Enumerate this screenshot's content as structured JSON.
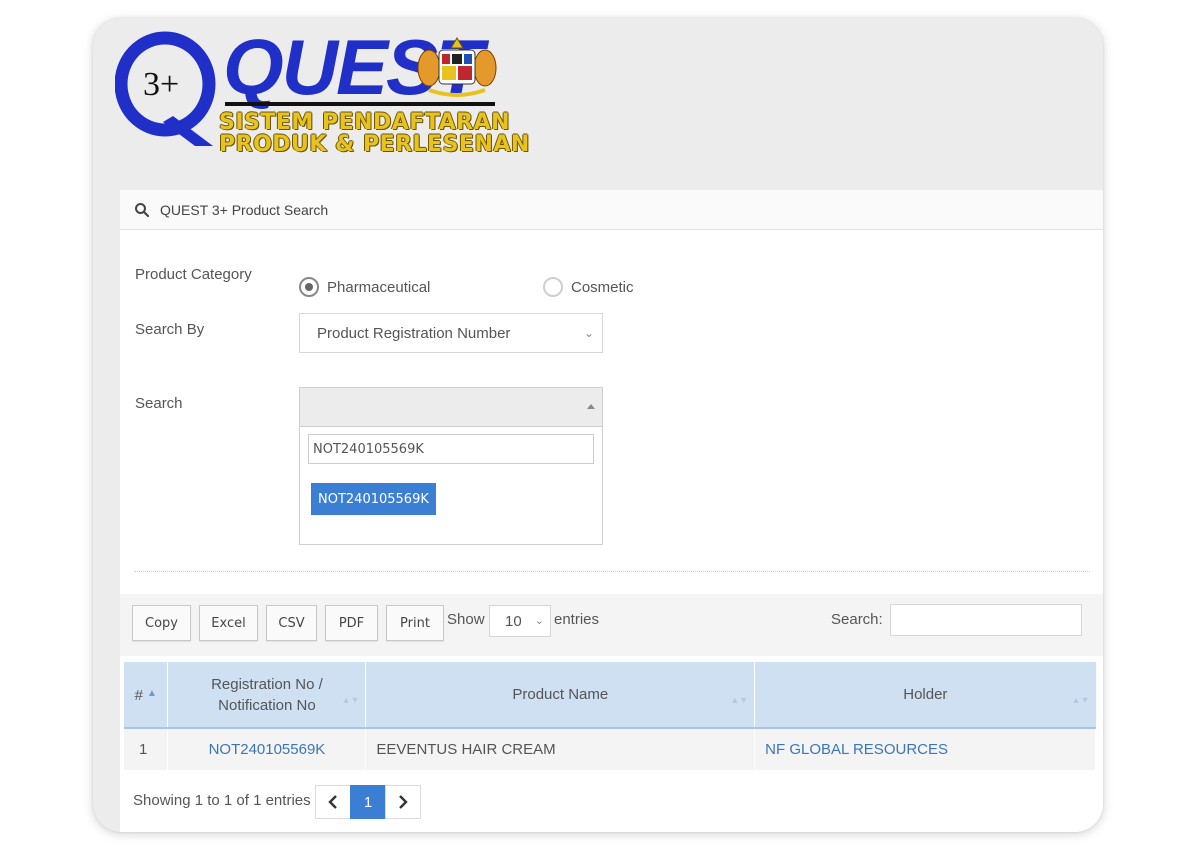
{
  "logo": {
    "text": "QUEST",
    "badge": "3+",
    "line1": "SISTEM PENDAFTARAN",
    "line2": "PRODUK & PERLESENAN"
  },
  "panel": {
    "title": "QUEST 3+ Product Search",
    "icon": "search-icon"
  },
  "form": {
    "category_label": "Product Category",
    "category_options": [
      "Pharmaceutical",
      "Cosmetic"
    ],
    "category_selected": "Pharmaceutical",
    "search_by_label": "Search By",
    "search_by_value": "Product Registration Number",
    "search_label": "Search",
    "search_typed": "NOT240105569K",
    "search_result": "NOT240105569K"
  },
  "toolbar": {
    "buttons": [
      "Copy",
      "Excel",
      "CSV",
      "PDF",
      "Print"
    ],
    "show_label": "Show",
    "entries_value": "10",
    "entries_label": "entries",
    "search_label": "Search:"
  },
  "table": {
    "columns": [
      "#",
      "Registration No / Notification No",
      "Product Name",
      "Holder"
    ],
    "rows": [
      {
        "index": "1",
        "reg_no": "NOT240105569K",
        "product": "EEVENTUS HAIR CREAM",
        "holder": "NF GLOBAL RESOURCES"
      }
    ]
  },
  "footer": {
    "info": "Showing 1 to 1 of 1 entries",
    "current_page": "1"
  },
  "colors": {
    "accent": "#3b7fd4",
    "header_bg": "#cfe0f3",
    "link": "#3a76b8",
    "logo_blue": "#1f2fc8",
    "logo_gold": "#e8c21e"
  }
}
